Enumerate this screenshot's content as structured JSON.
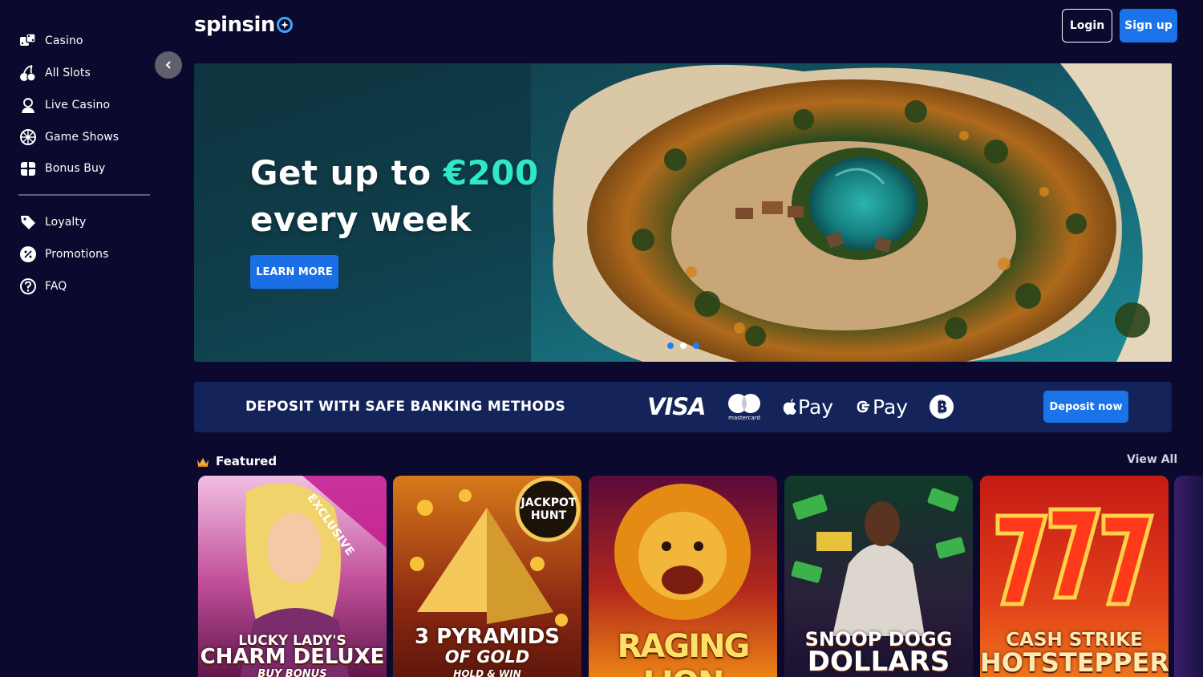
{
  "sidebar": {
    "items": [
      {
        "label": "Casino",
        "icon": "dice-icon"
      },
      {
        "label": "All Slots",
        "icon": "cherries-icon"
      },
      {
        "label": "Live Casino",
        "icon": "dealer-icon"
      },
      {
        "label": "Game Shows",
        "icon": "wheel-icon"
      },
      {
        "label": "Bonus Buy",
        "icon": "gift-icon"
      },
      {
        "label": "Loyalty",
        "icon": "tag-icon"
      },
      {
        "label": "Promotions",
        "icon": "percent-badge-icon"
      },
      {
        "label": "FAQ",
        "icon": "question-icon"
      }
    ]
  },
  "header": {
    "logo_text": "spinsin",
    "login_label": "Login",
    "signup_label": "Sign up"
  },
  "hero": {
    "title_prefix": "Get up to ",
    "title_accent": "€200",
    "title_line2": "every week",
    "cta_label": "LEARN MORE",
    "slides_total": 3,
    "active_slide": 2
  },
  "deposit": {
    "title": "DEPOSIT WITH SAFE BANKING METHODS",
    "methods": {
      "visa": "VISA",
      "mastercard": "mastercard",
      "applepay": "Pay",
      "googlepay": "Pay"
    },
    "cta_label": "Deposit now"
  },
  "featured": {
    "title": "Featured",
    "view_all": "View All",
    "games": [
      {
        "line1": "LUCKY LADY'S",
        "line2": "CHARM DELUXE",
        "line3": "BUY BONUS",
        "ribbon": "EXCLUSIVE"
      },
      {
        "line1": "3 PYRAMIDS",
        "line2": "OF GOLD",
        "line3": "HOLD & WIN",
        "badge1": "JACKPOT",
        "badge2": "HUNT"
      },
      {
        "line1": "RAGING LION"
      },
      {
        "line1": "SNOOP DOGG",
        "line2": "DOLLARS"
      },
      {
        "line1": "CASH STRIKE",
        "line2": "HOTSTEPPER"
      }
    ]
  },
  "colors": {
    "background": "#0b0a2e",
    "accent_blue": "#1a73e8",
    "accent_teal": "#2ee8c8",
    "banner": "#14245a"
  }
}
